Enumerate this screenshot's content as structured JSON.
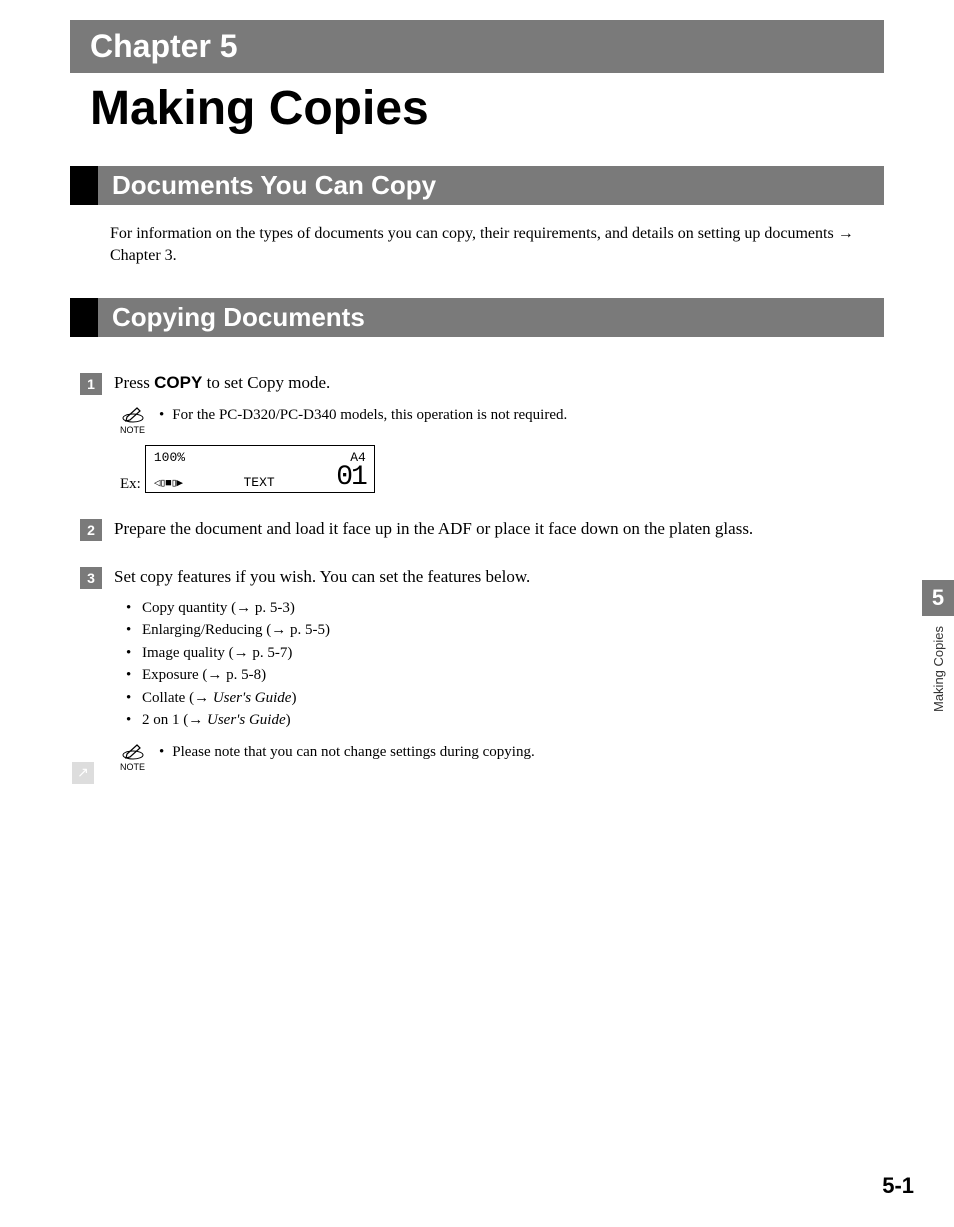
{
  "chapter": {
    "banner": "Chapter 5",
    "title": "Making Copies"
  },
  "sections": {
    "docs_you_can_copy": {
      "title": "Documents You Can Copy",
      "body": "For information on the types of documents you can copy, their requirements, and details on setting up documents → Chapter 3."
    },
    "copying_documents": {
      "title": "Copying Documents"
    }
  },
  "steps": {
    "s1": {
      "num": "1",
      "prefix": "Press ",
      "bold": "COPY",
      "suffix": " to set Copy mode."
    },
    "s2": {
      "num": "2",
      "text": "Prepare the document and load it face up in the ADF or place it face down on the platen glass."
    },
    "s3": {
      "num": "3",
      "text": "Set copy features if you wish. You can set the features below."
    }
  },
  "notes": {
    "label": "NOTE",
    "n1": "For the PC-D320/PC-D340 models, this operation is not required.",
    "n2": "Please note that you can not change settings during copying."
  },
  "lcd": {
    "ex_label": "Ex:",
    "zoom": "100%",
    "paper": "A4",
    "density_glyph": "◁▯■▯▶",
    "mode": "TEXT",
    "count": "01"
  },
  "features": {
    "f1": "Copy quantity (→ p. 5-3)",
    "f2": "Enlarging/Reducing (→ p. 5-5)",
    "f3": "Image quality (→ p. 5-7)",
    "f4": "Exposure (→ p. 5-8)",
    "f5_pre": "Collate (→ ",
    "f5_it": "User's Guide",
    "f5_post": ")",
    "f6_pre": "2 on 1 (→ ",
    "f6_it": "User's Guide",
    "f6_post": ")"
  },
  "sidetab": {
    "num": "5",
    "text": "Making Copies"
  },
  "page_num": "5-1",
  "arrow_glyph": "↗"
}
